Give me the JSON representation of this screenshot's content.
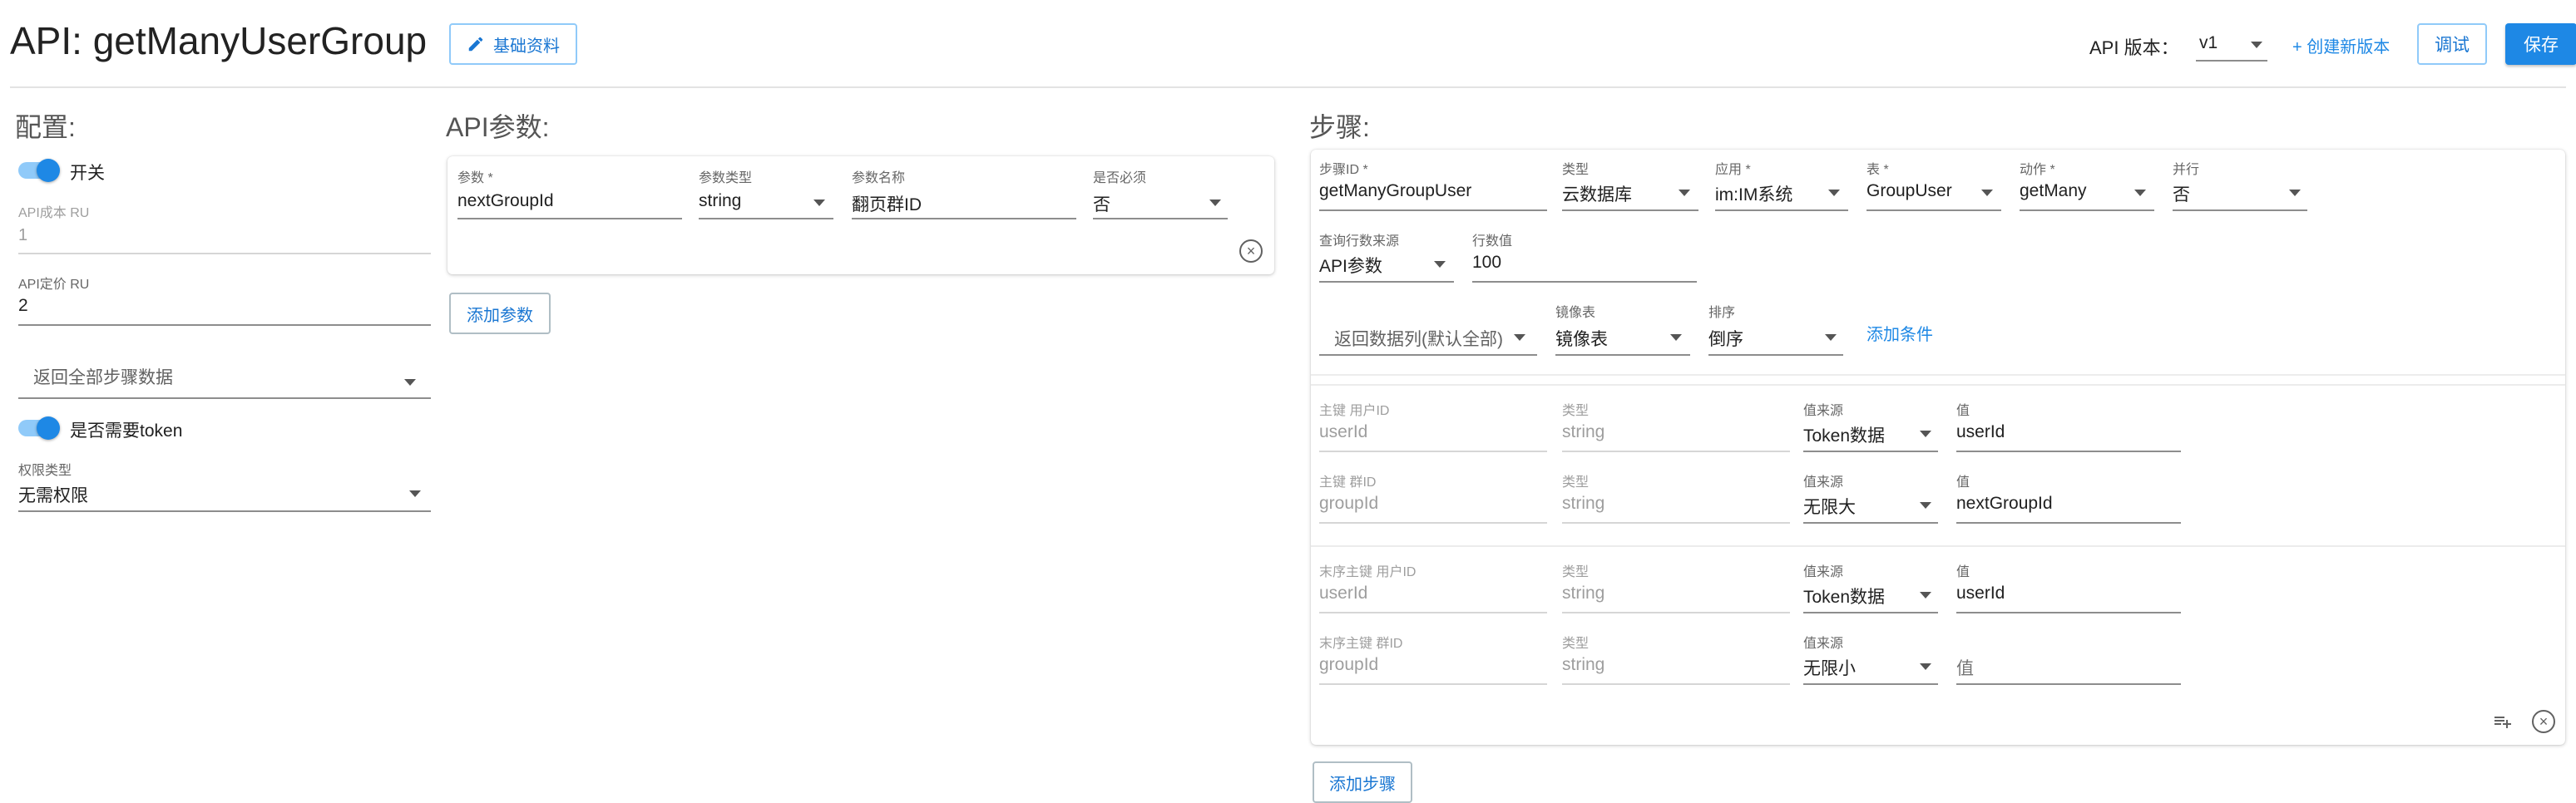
{
  "header": {
    "title": "API: getManyUserGroup",
    "basic_info_button": "基础资料",
    "version_label": "API 版本：",
    "version_value": "v1",
    "create_version_link": "+ 创建新版本",
    "debug_button": "调试",
    "save_button": "保存"
  },
  "config": {
    "heading": "配置:",
    "switch_label": "开关",
    "switch_on": true,
    "cost_label": "API成本 RU",
    "cost_value": "1",
    "price_label": "API定价 RU",
    "price_value": "2",
    "return_select_placeholder": "返回全部步骤数据",
    "token_label": "是否需要token",
    "token_on": true,
    "permission_label": "权限类型",
    "permission_value": "无需权限"
  },
  "params": {
    "heading": "API参数:",
    "columns": {
      "name": "参数 *",
      "type": "参数类型",
      "display": "参数名称",
      "required": "是否必须"
    },
    "rows": [
      {
        "name": "nextGroupId",
        "type": "string",
        "display": "翻页群ID",
        "required": "否"
      }
    ],
    "add_button": "添加参数"
  },
  "steps": {
    "heading": "步骤:",
    "step": {
      "step_id_label": "步骤ID *",
      "step_id": "getManyGroupUser",
      "type_label": "类型",
      "type": "云数据库",
      "app_label": "应用 *",
      "app": "im:IM系统",
      "table_label": "表 *",
      "table": "GroupUser",
      "action_label": "动作 *",
      "action": "getMany",
      "parallel_label": "并行",
      "parallel": "否",
      "row_source_label": "查询行数来源",
      "row_source": "API参数",
      "row_value_label": "行数值",
      "row_value": "100",
      "return_cols_placeholder": "返回数据列(默认全部)",
      "mirror_label": "镜像表",
      "mirror": "镜像表",
      "sort_label": "排序",
      "sort": "倒序",
      "add_condition": "添加条件",
      "key_rows": [
        {
          "key_label": "主键 用户ID",
          "key": "userId",
          "type_label": "类型",
          "type": "string",
          "source_label": "值来源",
          "source": "Token数据",
          "value_label": "值",
          "value": "userId",
          "value_is_placeholder": false
        },
        {
          "key_label": "主键 群ID",
          "key": "groupId",
          "type_label": "类型",
          "type": "string",
          "source_label": "值来源",
          "source": "无限大",
          "value_label": "值",
          "value": "nextGroupId",
          "value_is_placeholder": false
        },
        {
          "key_label": "末序主键 用户ID",
          "key": "userId",
          "type_label": "类型",
          "type": "string",
          "source_label": "值来源",
          "source": "Token数据",
          "value_label": "值",
          "value": "userId",
          "value_is_placeholder": false
        },
        {
          "key_label": "末序主键 群ID",
          "key": "groupId",
          "type_label": "类型",
          "type": "string",
          "source_label": "值来源",
          "source": "无限小",
          "value_label": "",
          "value": "值",
          "value_is_placeholder": true
        }
      ]
    },
    "add_step_button": "添加步骤"
  },
  "colors": {
    "primary": "#1e88e5",
    "outline": "#90caf9",
    "toggle_track": "#90caf9"
  },
  "icons": {
    "edit": "pencil-icon",
    "dropdown": "triangle-down-icon",
    "remove": "circle-x-icon",
    "add_row": "playlist-add-icon"
  }
}
